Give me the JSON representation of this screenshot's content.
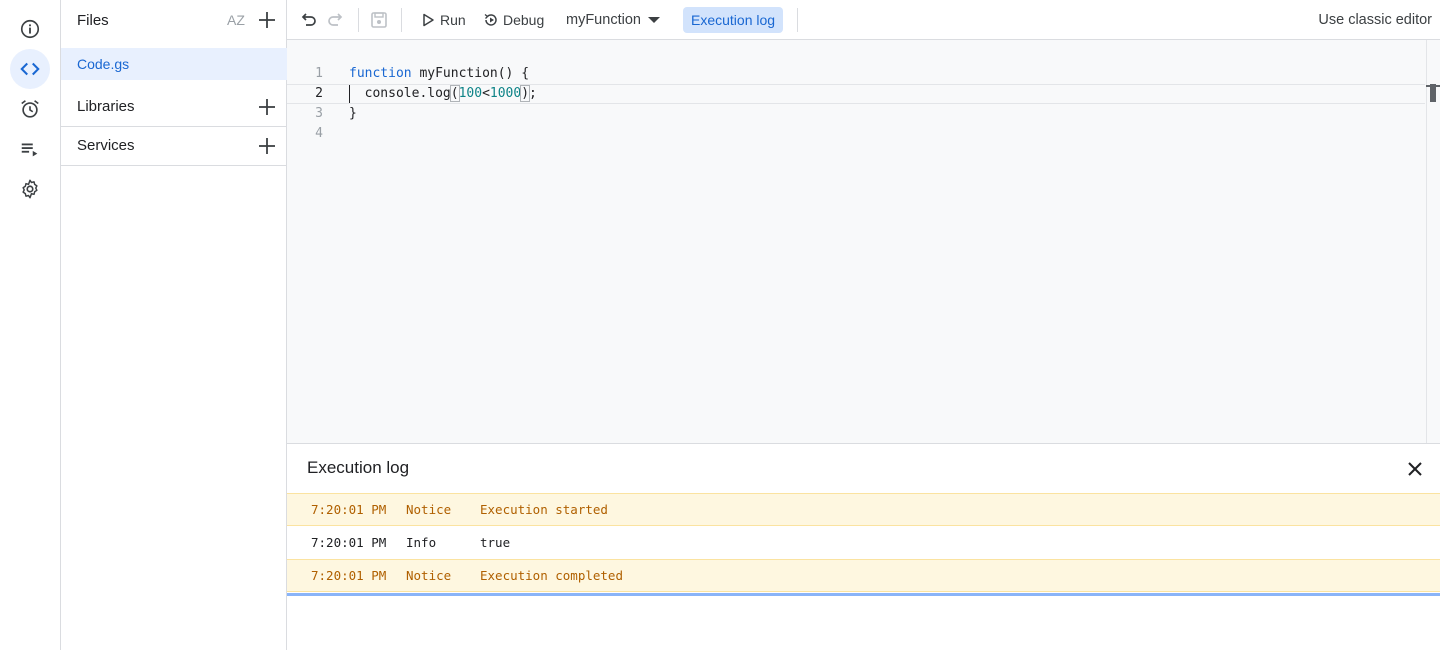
{
  "rail": {
    "items": [
      {
        "name": "overview",
        "icon": "info-icon"
      },
      {
        "name": "editor",
        "icon": "code-icon",
        "active": true
      },
      {
        "name": "triggers",
        "icon": "alarm-icon"
      },
      {
        "name": "executions",
        "icon": "playlist-play-icon"
      },
      {
        "name": "settings",
        "icon": "gear-icon"
      }
    ]
  },
  "files_panel": {
    "title": "Files",
    "sort_label": "AZ",
    "file": "Code.gs",
    "libraries_label": "Libraries",
    "services_label": "Services"
  },
  "toolbar": {
    "run_label": "Run",
    "debug_label": "Debug",
    "function_name": "myFunction",
    "execution_log_label": "Execution log",
    "classic_label": "Use classic editor"
  },
  "editor": {
    "line_numbers": [
      "1",
      "2",
      "3",
      "4"
    ],
    "line1_kw": "function",
    "line1_rest": " myFunction() {",
    "line2_a": "  console.log",
    "line2_open": "(",
    "line2_n1": "100",
    "line2_lt": "<",
    "line2_n2": "1000",
    "line2_close": ")",
    "line2_end": ";",
    "line3": "}",
    "line4": ""
  },
  "log": {
    "title": "Execution log",
    "rows": [
      {
        "time": "7:20:01 PM",
        "level": "Notice",
        "message": "Execution started"
      },
      {
        "time": "7:20:01 PM",
        "level": "Info",
        "message": "true"
      },
      {
        "time": "7:20:01 PM",
        "level": "Notice",
        "message": "Execution completed"
      }
    ]
  },
  "colors": {
    "accent": "#1967d2",
    "active_bg": "#e8f0fe",
    "notice_bg": "#fef7e0",
    "notice_text": "#b06000",
    "number": "#0d8387"
  }
}
